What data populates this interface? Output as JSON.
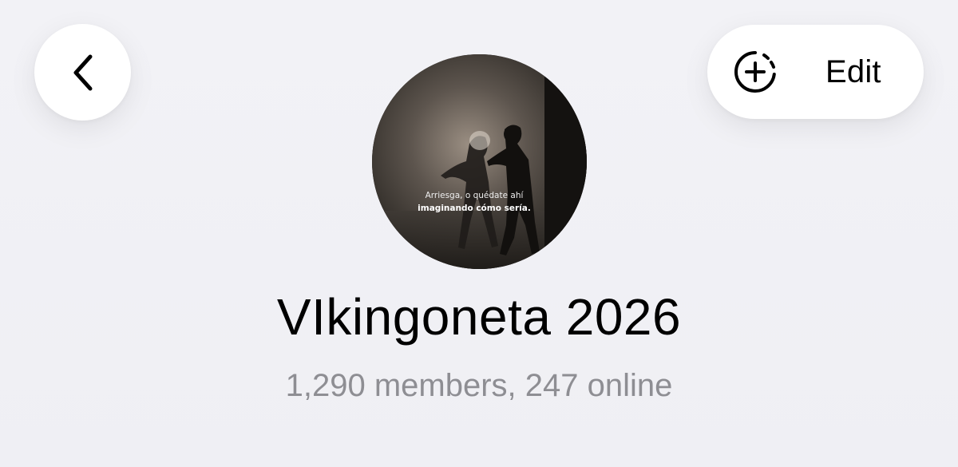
{
  "header": {
    "back_icon": "chevron-left-icon",
    "add_story_icon": "add-story-icon",
    "edit_label": "Edit"
  },
  "group": {
    "title": "VIkingoneta 2026",
    "subtitle": "1,290 members, 247 online",
    "avatar_caption_line1": "Arriesga, o quédate ahí",
    "avatar_caption_line2": "imaginando cómo sería."
  },
  "colors": {
    "background": "#efeff4",
    "button_bg": "#ffffff",
    "text": "#000000",
    "secondary_text": "#8e8e93"
  }
}
